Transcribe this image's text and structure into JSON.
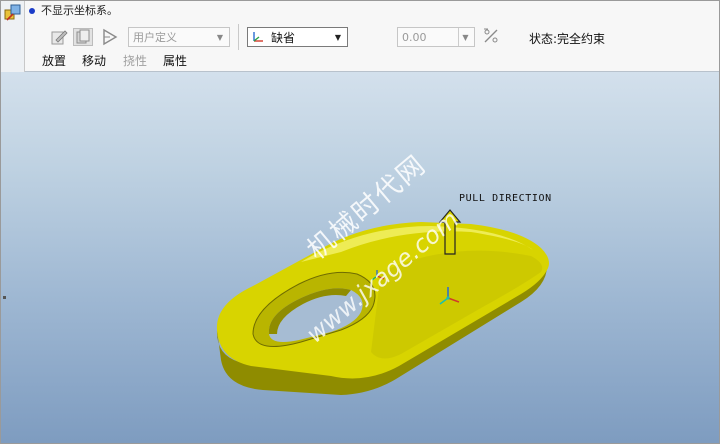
{
  "message": {
    "text": "不显示坐标系。"
  },
  "toolbar": {
    "reference_combo": {
      "value": "用户定义"
    },
    "csys_combo": {
      "value": "缺省"
    },
    "value_combo": {
      "value": "0.00"
    },
    "status": "状态:完全约束"
  },
  "tabs": [
    {
      "label": "放置",
      "enabled": true
    },
    {
      "label": "移动",
      "enabled": true
    },
    {
      "label": "挠性",
      "enabled": false
    },
    {
      "label": "属性",
      "enabled": true
    }
  ],
  "viewport": {
    "pull_direction_label": "PULL DIRECTION",
    "watermark_cn": "机械时代网",
    "watermark_url": "www.jxage.com"
  },
  "colors": {
    "model_yellow": "#d8d400",
    "model_shadow": "#8f8c00",
    "background_top": "#d3e0ec",
    "background_bottom": "#7e9cc0"
  }
}
